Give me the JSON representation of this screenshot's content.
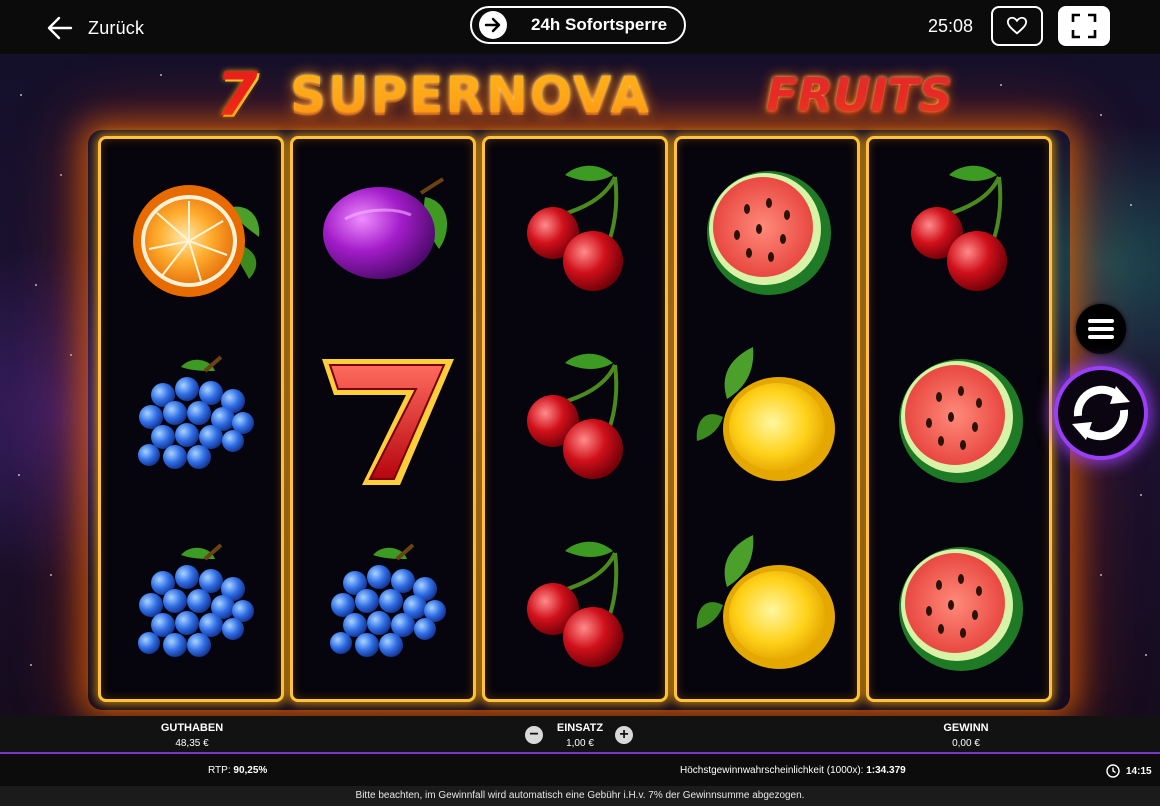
{
  "topbar": {
    "back_label": "Zurück",
    "selfban_label": "24h Sofortsperre",
    "session_time": "25:08"
  },
  "game": {
    "title_number": "7",
    "title_main": "SUPERNOVA",
    "title_fruits": "FRUITS",
    "reels": [
      [
        "orange",
        "grapes",
        "grapes"
      ],
      [
        "plum",
        "seven",
        "grapes"
      ],
      [
        "cherry",
        "cherry",
        "cherry"
      ],
      [
        "watermelon",
        "lemon",
        "lemon"
      ],
      [
        "cherry",
        "watermelon",
        "watermelon"
      ]
    ]
  },
  "panel": {
    "balance_label": "GUTHABEN",
    "balance_value": "48,35 €",
    "stake_label": "EINSATZ",
    "stake_value": "1,00 €",
    "stake_minus": "−",
    "stake_plus": "+",
    "win_label": "GEWINN",
    "win_value": "0,00 €"
  },
  "info": {
    "rtp_label": "RTP:",
    "rtp_value": "90,25%",
    "prob_label": "Höchstgewinnwahrscheinlichkeit (1000x):",
    "prob_value": "1:34.379",
    "clock_time": "14:15"
  },
  "notice": "Bitte beachten, im Gewinnfall wird automatisch eine Gebühr i.H.v. 7% der Gewinnsumme abgezogen.",
  "colors": {
    "reel_border": "#ffc23a",
    "spin_ring": "#9a3ff5",
    "panel_accent": "#7b36c9"
  },
  "icons": {
    "back": "arrow-left-icon",
    "selfban": "arrow-right-circle-icon",
    "favorite": "heart-icon",
    "fullscreen": "fullscreen-icon",
    "menu": "hamburger-menu-icon",
    "spin": "spin-arrows-icon",
    "clock": "clock-icon"
  }
}
